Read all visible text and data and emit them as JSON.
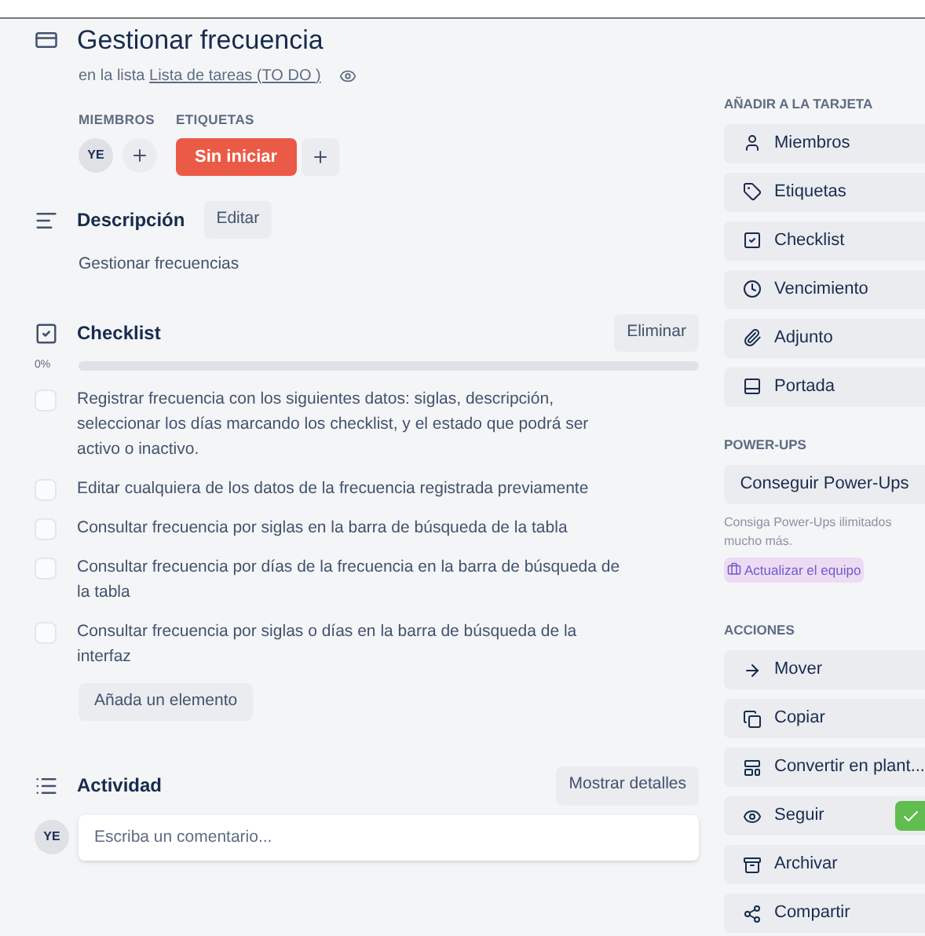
{
  "card": {
    "title": "Gestionar frecuencia",
    "list_prefix": "en la lista",
    "list_name": "Lista de tareas (TO DO )"
  },
  "members": {
    "label": "MIEMBROS",
    "avatars": [
      "YE"
    ]
  },
  "labels": {
    "label": "ETIQUETAS",
    "items": [
      {
        "text": "Sin iniciar",
        "color": "#eb5a46"
      }
    ]
  },
  "description": {
    "title": "Descripción",
    "edit_button": "Editar",
    "text": "Gestionar frecuencias"
  },
  "checklist": {
    "title": "Checklist",
    "delete_button": "Eliminar",
    "percent": "0%",
    "level": 0,
    "items": [
      {
        "text": "Registrar frecuencia con los siguientes datos: siglas, descripción, seleccionar los días marcando los checklist, y el estado que podrá ser activo o inactivo.",
        "checked": false
      },
      {
        "text": "Editar cualquiera de los datos de la frecuencia registrada previamente",
        "checked": false
      },
      {
        "text": "Consultar frecuencia por siglas en la barra de búsqueda de la tabla",
        "checked": false
      },
      {
        "text": "Consultar frecuencia por días de la frecuencia en la barra de búsqueda de la tabla",
        "checked": false
      },
      {
        "text": "Consultar frecuencia por siglas o días en la barra de búsqueda de la interfaz",
        "checked": false
      }
    ],
    "add_button": "Añada un elemento"
  },
  "activity": {
    "title": "Actividad",
    "details_button": "Mostrar detalles",
    "avatar": "YE",
    "comment_placeholder": "Escriba un comentario..."
  },
  "sidebar": {
    "add_title": "AÑADIR A LA TARJETA",
    "add_items": [
      {
        "label": "Miembros",
        "kind": "user"
      },
      {
        "label": "Etiquetas",
        "kind": "tag"
      },
      {
        "label": "Checklist",
        "kind": "checklist"
      },
      {
        "label": "Vencimiento",
        "kind": "clock"
      },
      {
        "label": "Adjunto",
        "kind": "attachment"
      },
      {
        "label": "Portada",
        "kind": "cover"
      }
    ],
    "powerups_title": "POWER-UPS",
    "powerups_button": "Conseguir Power-Ups",
    "powerups_text": "Consiga Power-Ups ilimitados\nmucho más.",
    "upgrade_link": "Actualizar el equipo",
    "actions_title": "ACCIONES",
    "actions": [
      {
        "label": "Mover",
        "kind": "move"
      },
      {
        "label": "Copiar",
        "kind": "copy"
      },
      {
        "label": "Convertir en plant...",
        "kind": "template"
      },
      {
        "label": "Seguir",
        "kind": "watch",
        "checked": true
      },
      {
        "label": "Archivar",
        "kind": "archive"
      },
      {
        "label": "Compartir",
        "kind": "share"
      }
    ]
  }
}
